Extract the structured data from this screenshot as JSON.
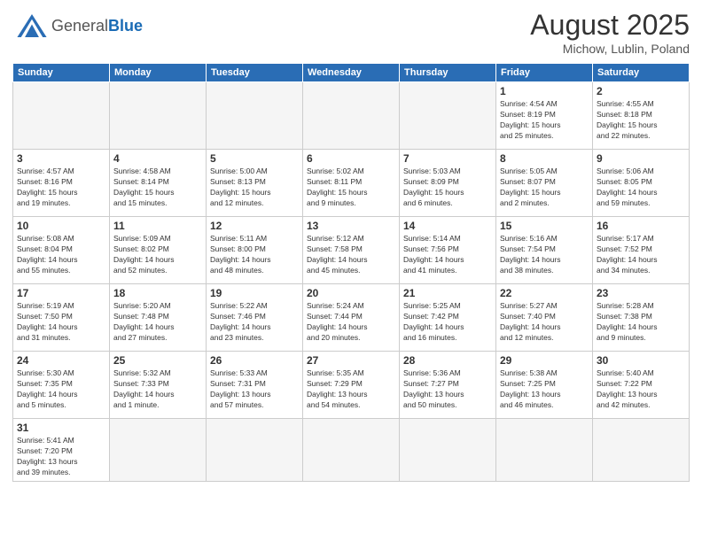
{
  "header": {
    "logo_general": "General",
    "logo_blue": "Blue",
    "month_year": "August 2025",
    "location": "Michow, Lublin, Poland"
  },
  "days_of_week": [
    "Sunday",
    "Monday",
    "Tuesday",
    "Wednesday",
    "Thursday",
    "Friday",
    "Saturday"
  ],
  "weeks": [
    [
      {
        "day": "",
        "info": ""
      },
      {
        "day": "",
        "info": ""
      },
      {
        "day": "",
        "info": ""
      },
      {
        "day": "",
        "info": ""
      },
      {
        "day": "",
        "info": ""
      },
      {
        "day": "1",
        "info": "Sunrise: 4:54 AM\nSunset: 8:19 PM\nDaylight: 15 hours\nand 25 minutes."
      },
      {
        "day": "2",
        "info": "Sunrise: 4:55 AM\nSunset: 8:18 PM\nDaylight: 15 hours\nand 22 minutes."
      }
    ],
    [
      {
        "day": "3",
        "info": "Sunrise: 4:57 AM\nSunset: 8:16 PM\nDaylight: 15 hours\nand 19 minutes."
      },
      {
        "day": "4",
        "info": "Sunrise: 4:58 AM\nSunset: 8:14 PM\nDaylight: 15 hours\nand 15 minutes."
      },
      {
        "day": "5",
        "info": "Sunrise: 5:00 AM\nSunset: 8:13 PM\nDaylight: 15 hours\nand 12 minutes."
      },
      {
        "day": "6",
        "info": "Sunrise: 5:02 AM\nSunset: 8:11 PM\nDaylight: 15 hours\nand 9 minutes."
      },
      {
        "day": "7",
        "info": "Sunrise: 5:03 AM\nSunset: 8:09 PM\nDaylight: 15 hours\nand 6 minutes."
      },
      {
        "day": "8",
        "info": "Sunrise: 5:05 AM\nSunset: 8:07 PM\nDaylight: 15 hours\nand 2 minutes."
      },
      {
        "day": "9",
        "info": "Sunrise: 5:06 AM\nSunset: 8:05 PM\nDaylight: 14 hours\nand 59 minutes."
      }
    ],
    [
      {
        "day": "10",
        "info": "Sunrise: 5:08 AM\nSunset: 8:04 PM\nDaylight: 14 hours\nand 55 minutes."
      },
      {
        "day": "11",
        "info": "Sunrise: 5:09 AM\nSunset: 8:02 PM\nDaylight: 14 hours\nand 52 minutes."
      },
      {
        "day": "12",
        "info": "Sunrise: 5:11 AM\nSunset: 8:00 PM\nDaylight: 14 hours\nand 48 minutes."
      },
      {
        "day": "13",
        "info": "Sunrise: 5:12 AM\nSunset: 7:58 PM\nDaylight: 14 hours\nand 45 minutes."
      },
      {
        "day": "14",
        "info": "Sunrise: 5:14 AM\nSunset: 7:56 PM\nDaylight: 14 hours\nand 41 minutes."
      },
      {
        "day": "15",
        "info": "Sunrise: 5:16 AM\nSunset: 7:54 PM\nDaylight: 14 hours\nand 38 minutes."
      },
      {
        "day": "16",
        "info": "Sunrise: 5:17 AM\nSunset: 7:52 PM\nDaylight: 14 hours\nand 34 minutes."
      }
    ],
    [
      {
        "day": "17",
        "info": "Sunrise: 5:19 AM\nSunset: 7:50 PM\nDaylight: 14 hours\nand 31 minutes."
      },
      {
        "day": "18",
        "info": "Sunrise: 5:20 AM\nSunset: 7:48 PM\nDaylight: 14 hours\nand 27 minutes."
      },
      {
        "day": "19",
        "info": "Sunrise: 5:22 AM\nSunset: 7:46 PM\nDaylight: 14 hours\nand 23 minutes."
      },
      {
        "day": "20",
        "info": "Sunrise: 5:24 AM\nSunset: 7:44 PM\nDaylight: 14 hours\nand 20 minutes."
      },
      {
        "day": "21",
        "info": "Sunrise: 5:25 AM\nSunset: 7:42 PM\nDaylight: 14 hours\nand 16 minutes."
      },
      {
        "day": "22",
        "info": "Sunrise: 5:27 AM\nSunset: 7:40 PM\nDaylight: 14 hours\nand 12 minutes."
      },
      {
        "day": "23",
        "info": "Sunrise: 5:28 AM\nSunset: 7:38 PM\nDaylight: 14 hours\nand 9 minutes."
      }
    ],
    [
      {
        "day": "24",
        "info": "Sunrise: 5:30 AM\nSunset: 7:35 PM\nDaylight: 14 hours\nand 5 minutes."
      },
      {
        "day": "25",
        "info": "Sunrise: 5:32 AM\nSunset: 7:33 PM\nDaylight: 14 hours\nand 1 minute."
      },
      {
        "day": "26",
        "info": "Sunrise: 5:33 AM\nSunset: 7:31 PM\nDaylight: 13 hours\nand 57 minutes."
      },
      {
        "day": "27",
        "info": "Sunrise: 5:35 AM\nSunset: 7:29 PM\nDaylight: 13 hours\nand 54 minutes."
      },
      {
        "day": "28",
        "info": "Sunrise: 5:36 AM\nSunset: 7:27 PM\nDaylight: 13 hours\nand 50 minutes."
      },
      {
        "day": "29",
        "info": "Sunrise: 5:38 AM\nSunset: 7:25 PM\nDaylight: 13 hours\nand 46 minutes."
      },
      {
        "day": "30",
        "info": "Sunrise: 5:40 AM\nSunset: 7:22 PM\nDaylight: 13 hours\nand 42 minutes."
      }
    ],
    [
      {
        "day": "31",
        "info": "Sunrise: 5:41 AM\nSunset: 7:20 PM\nDaylight: 13 hours\nand 39 minutes."
      },
      {
        "day": "",
        "info": ""
      },
      {
        "day": "",
        "info": ""
      },
      {
        "day": "",
        "info": ""
      },
      {
        "day": "",
        "info": ""
      },
      {
        "day": "",
        "info": ""
      },
      {
        "day": "",
        "info": ""
      }
    ]
  ]
}
